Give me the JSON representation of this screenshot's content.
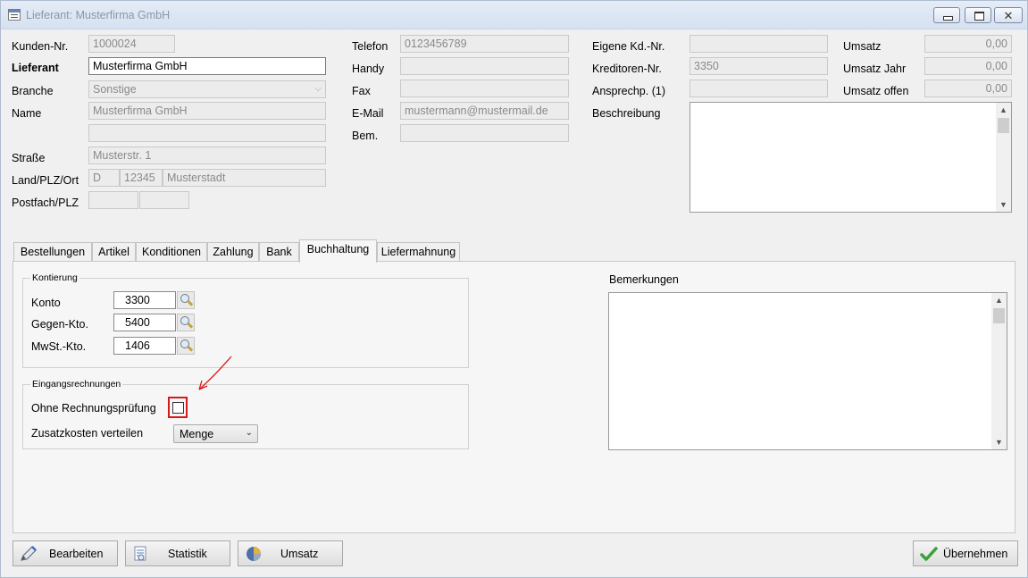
{
  "window": {
    "title": "Lieferant: Musterfirma GmbH",
    "close_glyph": "✕"
  },
  "left": {
    "kunden_nr": {
      "label": "Kunden-Nr.",
      "value": "1000024"
    },
    "lieferant": {
      "label": "Lieferant",
      "value": "Musterfirma GmbH"
    },
    "branche": {
      "label": "Branche",
      "value": "Sonstige"
    },
    "name": {
      "label": "Name",
      "value": "Musterfirma GmbH",
      "value2": ""
    },
    "strasse": {
      "label": "Straße",
      "value": "Musterstr. 1"
    },
    "land_plz_ort": {
      "label": "Land/PLZ/Ort",
      "land": "D",
      "plz": "12345",
      "ort": "Musterstadt"
    },
    "postfach": {
      "label": "Postfach/PLZ",
      "postfach": "",
      "plz": ""
    }
  },
  "mid": {
    "telefon": {
      "label": "Telefon",
      "value": "0123456789"
    },
    "handy": {
      "label": "Handy",
      "value": ""
    },
    "fax": {
      "label": "Fax",
      "value": ""
    },
    "email": {
      "label": "E-Mail",
      "value": "mustermann@mustermail.de"
    },
    "bem": {
      "label": "Bem.",
      "value": ""
    }
  },
  "right": {
    "eigene_kd_nr": {
      "label": "Eigene Kd.-Nr.",
      "value": ""
    },
    "kreditoren_nr": {
      "label": "Kreditoren-Nr.",
      "value": "3350"
    },
    "ansprechp": {
      "label": "Ansprechp. (1)",
      "value": ""
    },
    "beschreibung": {
      "label": "Beschreibung"
    },
    "umsatz": {
      "label": "Umsatz",
      "value": "0,00"
    },
    "umsatz_jahr": {
      "label": "Umsatz Jahr",
      "value": "0,00"
    },
    "umsatz_offen": {
      "label": "Umsatz offen",
      "value": "0,00"
    }
  },
  "tabs": [
    "Bestellungen",
    "Artikel",
    "Konditionen",
    "Zahlung",
    "Bank",
    "Buchhaltung",
    "Liefermahnung"
  ],
  "active_tab": "Buchhaltung",
  "kontierung": {
    "title": "Kontierung",
    "konto": {
      "label": "Konto",
      "value": "3300"
    },
    "gegen_kto": {
      "label": "Gegen-Kto.",
      "value": "5400"
    },
    "mwst_kto": {
      "label": "MwSt.-Kto.",
      "value": "1406"
    }
  },
  "eingangsrechnungen": {
    "title": "Eingangsrechnungen",
    "ohne_pruefung": {
      "label": "Ohne Rechnungsprüfung",
      "checked": false
    },
    "zusatzkosten": {
      "label": "Zusatzkosten verteilen",
      "value": "Menge"
    }
  },
  "bemerkungen": {
    "label": "Bemerkungen"
  },
  "buttons": {
    "bearbeiten": "Bearbeiten",
    "statistik": "Statistik",
    "umsatz": "Umsatz",
    "uebernehmen": "Übernehmen"
  },
  "colors": {
    "annotation_red": "#d41a1a",
    "check_green": "#3aa03a"
  }
}
